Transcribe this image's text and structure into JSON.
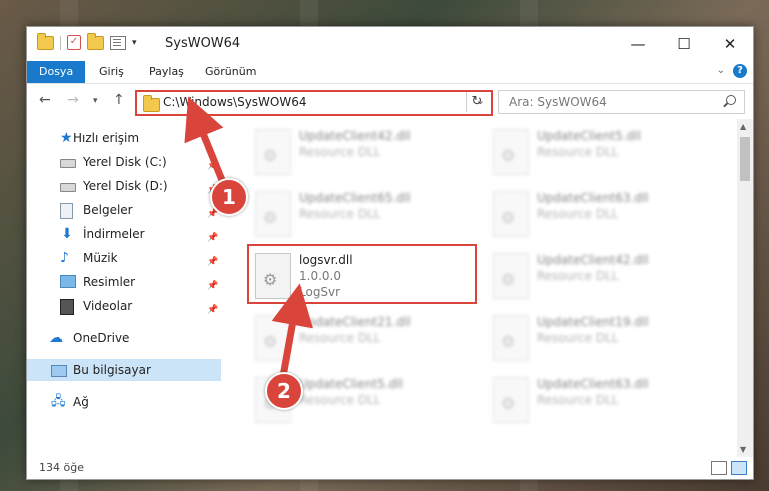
{
  "window": {
    "title": "SysWOW64",
    "minimize": "—",
    "maximize": "☐",
    "close": "✕"
  },
  "ribbon": {
    "tabs": [
      "Dosya",
      "Giriş",
      "Paylaş",
      "Görünüm"
    ],
    "active_tab": "Dosya",
    "help": "?"
  },
  "address": {
    "path": "C:\\Windows\\SysWOW64",
    "search_placeholder": "Ara: SysWOW64"
  },
  "sidebar": {
    "items": [
      {
        "label": "Hızlı erişim",
        "icon": "star-icon"
      },
      {
        "label": "Yerel Disk (C:)",
        "icon": "drive-icon",
        "pinned": true
      },
      {
        "label": "Yerel Disk (D:)",
        "icon": "drive-icon",
        "pinned": true
      },
      {
        "label": "Belgeler",
        "icon": "documents-icon",
        "pinned": true
      },
      {
        "label": "İndirmeler",
        "icon": "download-icon",
        "pinned": true
      },
      {
        "label": "Müzik",
        "icon": "music-icon",
        "pinned": true
      },
      {
        "label": "Resimler",
        "icon": "pictures-icon",
        "pinned": true
      },
      {
        "label": "Videolar",
        "icon": "videos-icon",
        "pinned": true
      },
      {
        "label": "OneDrive",
        "icon": "onedrive-icon"
      },
      {
        "label": "Bu bilgisayar",
        "icon": "computer-icon",
        "selected": true
      },
      {
        "label": "Ağ",
        "icon": "network-icon"
      }
    ]
  },
  "files": [
    {
      "name": "UpdateClient42.dll",
      "version": "",
      "type": "Resource DLL"
    },
    {
      "name": "UpdateClient5.dll",
      "version": "",
      "type": "Resource DLL"
    },
    {
      "name": "UpdateClient65.dll",
      "version": "",
      "type": "Resource DLL"
    },
    {
      "name": "UpdateClient63.dll",
      "version": "",
      "type": "Resource DLL"
    },
    {
      "name": "logsvr.dll",
      "version": "1.0.0.0",
      "type": "LogSvr"
    },
    {
      "name": "UpdateClient42.dll",
      "version": "",
      "type": "Resource DLL"
    },
    {
      "name": "UpdateClient21.dll",
      "version": "",
      "type": "Resource DLL"
    },
    {
      "name": "UpdateClient19.dll",
      "version": "",
      "type": "Resource DLL"
    },
    {
      "name": "UpdateClient5.dll",
      "version": "",
      "type": "Resource DLL"
    },
    {
      "name": "UpdateClient63.dll",
      "version": "",
      "type": "Resource DLL"
    }
  ],
  "status": {
    "count": "134 öğe"
  },
  "callouts": [
    "1",
    "2"
  ],
  "colors": {
    "accent": "#1979ca",
    "highlight": "#d9453b",
    "selection": "#cce4f7"
  }
}
